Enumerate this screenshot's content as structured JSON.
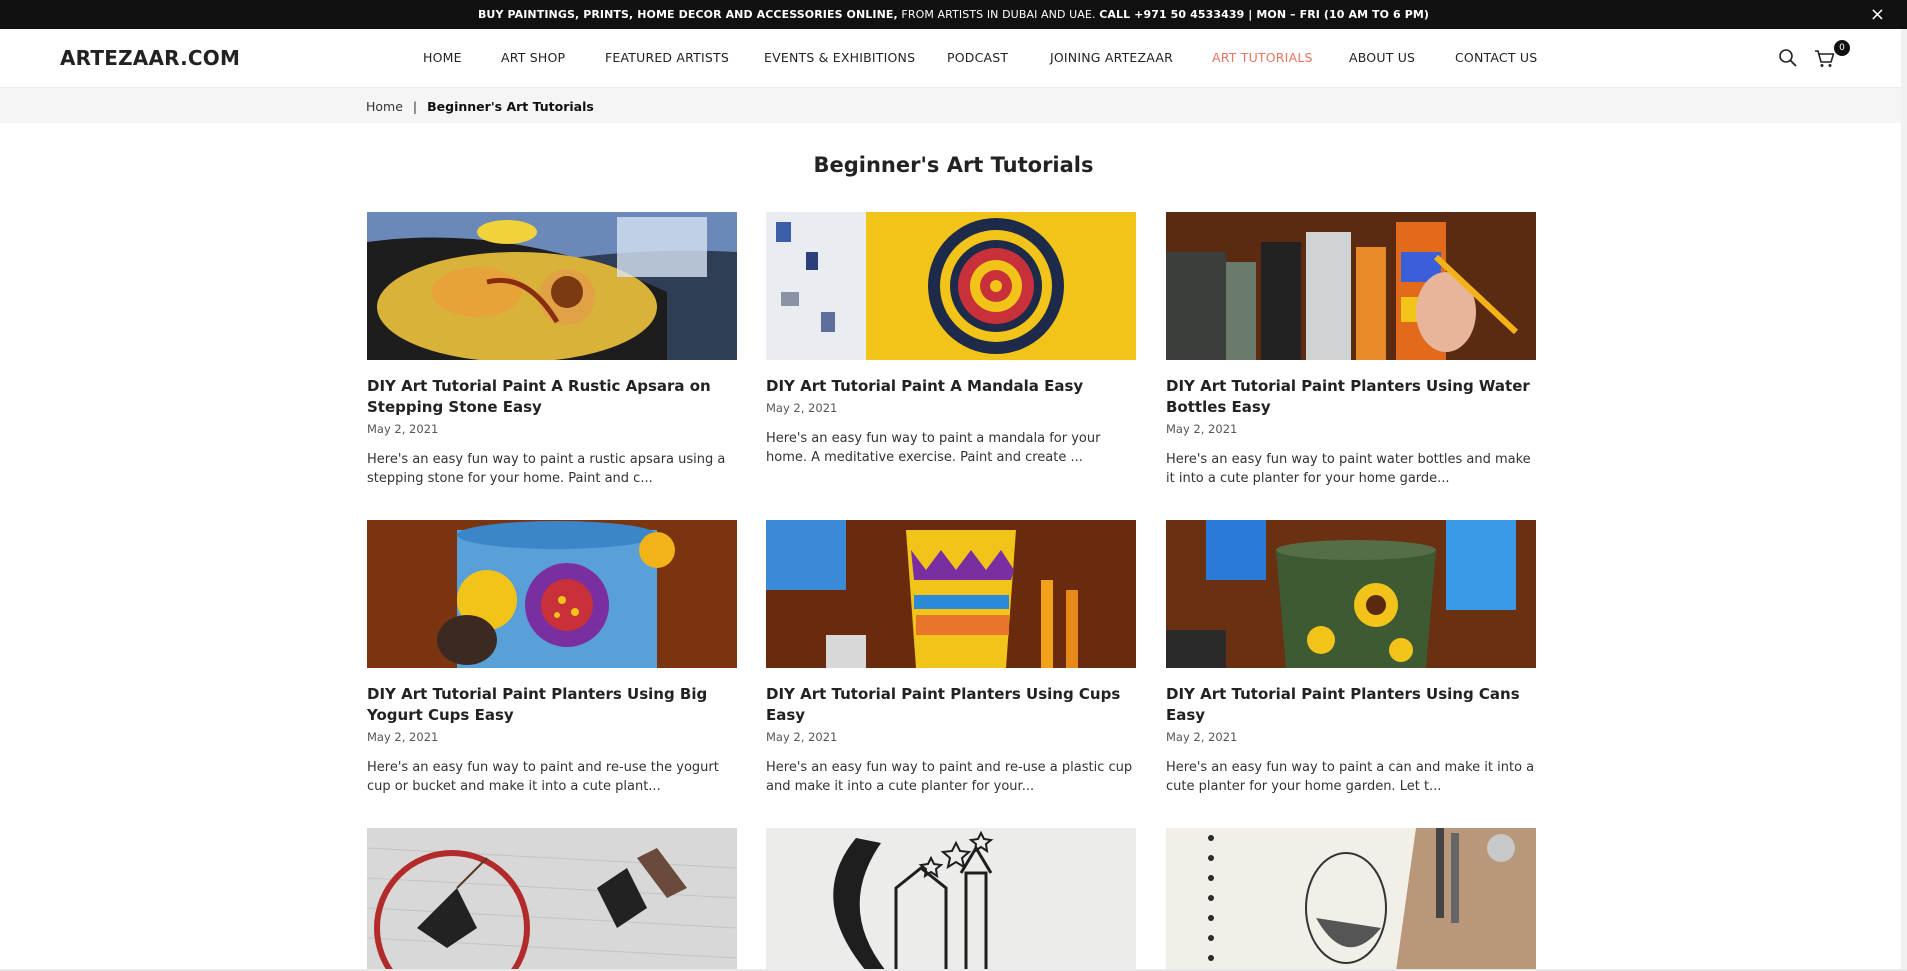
{
  "announcement": {
    "bold_text": "BUY PAINTINGS, PRINTS, HOME DECOR AND ACCESSORIES ONLINE,",
    "normal_text": " FROM ARTISTS IN DUBAI AND UAE. ",
    "bold_call": "CALL +971 50 4533439 | MON – FRI (10 AM TO 6 PM)",
    "close_icon": "×"
  },
  "header": {
    "logo": "ARTEZAAR.COM",
    "nav": [
      {
        "label": "HOME"
      },
      {
        "label": "ART SHOP"
      },
      {
        "label": "FEATURED ARTISTS"
      },
      {
        "label": "EVENTS & EXHIBITIONS"
      },
      {
        "label": "PODCAST"
      },
      {
        "label": "JOINING ARTEZAAR"
      },
      {
        "label": "ART TUTORIALS"
      },
      {
        "label": "ABOUT US"
      },
      {
        "label": "CONTACT US"
      }
    ],
    "active_color": "#e8765e",
    "cart_count": "0",
    "icons": [
      "search-icon",
      "cart-icon"
    ]
  },
  "breadcrumb": {
    "home": "Home",
    "separator": "|",
    "current": "Beginner's Art Tutorials"
  },
  "page": {
    "title": "Beginner's Art Tutorials"
  },
  "articles": [
    {
      "title": "DIY Art Tutorial Paint A Rustic Apsara on Stepping Stone Easy",
      "date": "May 2, 2021",
      "excerpt": "Here's an easy fun way to paint a rustic apsara using a stepping stone for your home. Paint and c..."
    },
    {
      "title": "DIY Art Tutorial Paint A Mandala Easy",
      "date": "May 2, 2021",
      "excerpt": "Here's an easy fun way to paint a mandala for your home. A meditative exercise. Paint and create ..."
    },
    {
      "title": "DIY Art Tutorial Paint Planters Using Water Bottles Easy",
      "date": "May 2, 2021",
      "excerpt": "Here's an easy fun way to paint water bottles and make it into a cute planter for your home garde..."
    },
    {
      "title": "DIY Art Tutorial Paint Planters Using Big Yogurt Cups Easy",
      "date": "May 2, 2021",
      "excerpt": "Here's an easy fun way to paint and re-use the yogurt cup or bucket and make it into a cute plant..."
    },
    {
      "title": "DIY Art Tutorial Paint Planters Using Cups Easy",
      "date": "May 2, 2021",
      "excerpt": "Here's an easy fun way to paint and re-use a plastic cup and make it into a cute planter for your..."
    },
    {
      "title": "DIY Art Tutorial Paint Planters Using Cans Easy",
      "date": "May 2, 2021",
      "excerpt": "Here's an easy fun way to paint a can and make it into a cute planter for your home garden. Let t..."
    }
  ]
}
